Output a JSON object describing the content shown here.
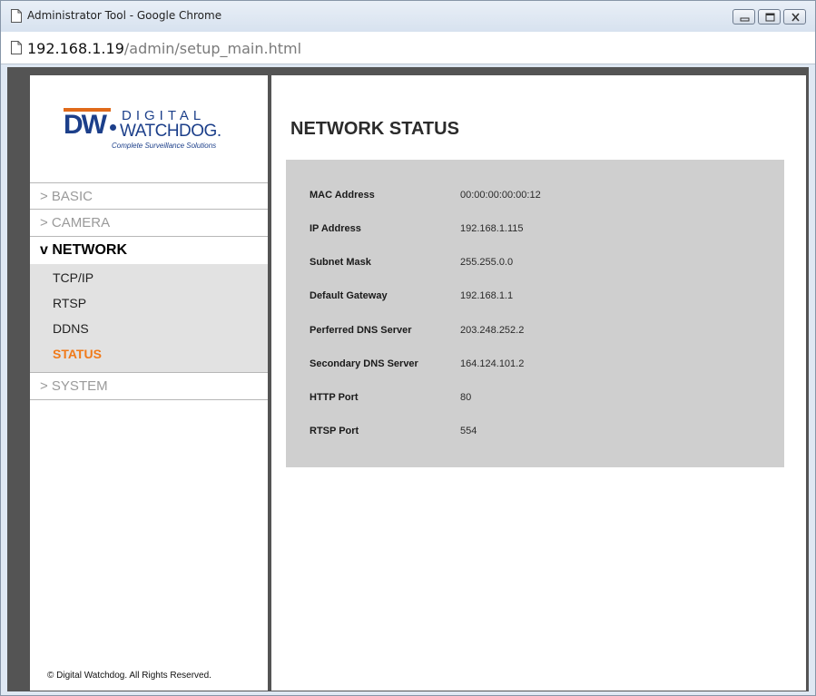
{
  "window": {
    "title": "Administrator Tool - Google Chrome",
    "url_host": "192.168.1.19",
    "url_path": "/admin/setup_main.html"
  },
  "logo": {
    "mark": "DW",
    "line1": "DIGITAL",
    "line2": "WATCHDOG.",
    "tagline": "Complete Surveillance Solutions"
  },
  "nav": {
    "basic": "> BASIC",
    "camera": "> CAMERA",
    "network": "v NETWORK",
    "sub": {
      "tcpip": "TCP/IP",
      "rtsp": "RTSP",
      "ddns": "DDNS",
      "status": "STATUS"
    },
    "system": "> SYSTEM"
  },
  "footer": {
    "copyright": "© Digital Watchdog. All Rights Reserved."
  },
  "page": {
    "title": "NETWORK STATUS"
  },
  "status": [
    {
      "label": "MAC Address",
      "value": "00:00:00:00:00:12"
    },
    {
      "label": "IP Address",
      "value": "192.168.1.115"
    },
    {
      "label": "Subnet Mask",
      "value": "255.255.0.0"
    },
    {
      "label": "Default Gateway",
      "value": "192.168.1.1"
    },
    {
      "label": "Perferred DNS Server",
      "value": "203.248.252.2"
    },
    {
      "label": "Secondary DNS Server",
      "value": "164.124.101.2"
    },
    {
      "label": "HTTP Port",
      "value": "80"
    },
    {
      "label": "RTSP Port",
      "value": "554"
    }
  ],
  "colors": {
    "accent": "#f07a1a",
    "brand": "#1c3f8a",
    "panel": "#cfcfcf",
    "frame": "#545454"
  },
  "icons": {
    "title": "page-icon",
    "address": "page-icon",
    "minimize": "minimize-icon",
    "maximize": "maximize-icon",
    "close": "close-icon"
  }
}
